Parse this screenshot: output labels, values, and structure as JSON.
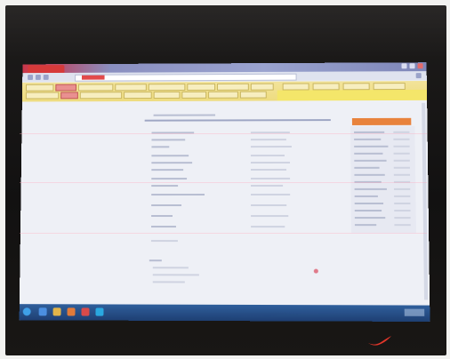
{
  "photo": {
    "subject": "monitor-displaying-browser-with-spreadsheet-page"
  },
  "colors": {
    "bezel": "#151313",
    "browser_titlebar": "#8a8fc0",
    "browser_tab_accent": "#d63a3a",
    "bookmarks_bar": "#eedc7f",
    "page_background": "#eef0f6",
    "side_panel_header": "#e8823c",
    "taskbar": "#1e3f73",
    "lamp_glow": "#e2362a"
  },
  "icons": {
    "start": "windows-start-icon",
    "taskbar_apps": [
      "ie-icon",
      "folder-icon",
      "media-icon",
      "chrome-icon",
      "skype-icon"
    ],
    "side_marker": "pink-dot-icon"
  }
}
